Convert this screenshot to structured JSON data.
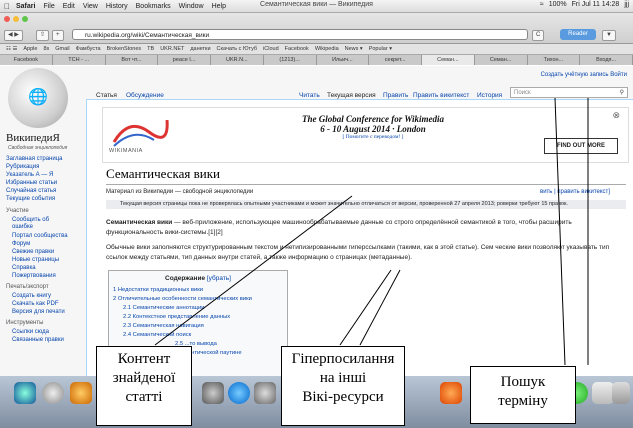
{
  "menubar": {
    "app": "Safari",
    "items": [
      "File",
      "Edit",
      "View",
      "History",
      "Bookmarks",
      "Window",
      "Help"
    ],
    "window_title": "Семантическая вики — Википедия",
    "battery": "100%",
    "clock": "Fri Jul 11  14:28",
    "user": "jjj"
  },
  "toolbar": {
    "url": "ru.wikipedia.org/wiki/Семантическая_вики",
    "reader": "Reader",
    "reload": "C"
  },
  "bookmarks": [
    "Apple",
    "8s",
    "Gmail",
    "Фамбуста",
    "BrokenStones",
    "TB",
    "UKR.NET",
    "данетки",
    "Скачать с Ютуб",
    "iCloud",
    "Facebook",
    "Wikipedia",
    "News ▾",
    "Popular ▾"
  ],
  "tabs": [
    "Facebook",
    "TCH - ...",
    "Вот чт...",
    "peace I...",
    "UKR.N...",
    "(1213)...",
    "Ильич...",
    "секрет...",
    "Семан...",
    "Семан...",
    "Тихон...",
    "Входя..."
  ],
  "wiki": {
    "name": "ВикипедиЯ",
    "tagline": "Свободная энциклопедия",
    "top_links": "Создать учётную запись  Войти",
    "page_tabs": [
      "Статья",
      "Обсуждение"
    ],
    "view_tabs": [
      "Читать",
      "Текущая версия",
      "Править",
      "Править викитекст",
      "История"
    ],
    "search_placeholder": "Поиск",
    "sidebar_nav": [
      "Заглавная страница",
      "Рубрикация",
      "Указатель А — Я",
      "Избранные статьи",
      "Случайная статья",
      "Текущие события"
    ],
    "sidebar_participation_head": "Участие",
    "sidebar_participation": [
      "Сообщить об",
      "ошибке",
      "Портал сообщества",
      "Форум",
      "Свежие правки",
      "Новые страницы",
      "Справка",
      "Пожертвования"
    ],
    "sidebar_print_head": "Печать/экспорт",
    "sidebar_print": [
      "Создать книгу",
      "Скачать как PDF",
      "Версия для печати"
    ],
    "sidebar_tools_head": "Инструменты",
    "sidebar_tools": [
      "Ссылки сюда",
      "Связанные правки"
    ],
    "banner_title_1": "The Global Conference for Wikimedia",
    "banner_title_2": "6 - 10 August 2014 · London",
    "banner_help": "[ Помогите с переводом! ]",
    "banner_logo": "WIKIMANIA",
    "banner_button": "FIND OUT MORE",
    "article_title": "Семантическая вики",
    "from_line": "Материал из Википедии — свободной энциклопедии",
    "edit_links": "вить | править викитекст]",
    "notice": "Текущая версия страницы пока не проверялась опытными участниками и может значительно отличаться от версии, проверенной 27 апреля 2013; роверки требуют 15 правок.",
    "para1_a": "Семантическая вики",
    "para1_b": " — веб-приложение, использующее машинообрабатываемые данные со строго определённой семантикой в           того, чтобы расширить функциональность вики-системы.[1][2]",
    "para2": "Обычные вики заполняются структурированным текстом и нетипизированными гиперссылками (такими, как в этой статье). Сем       ческие вики позволяют указывать тип ссылок между статьями, тип данных внутри статей, а также информацию о страницах (метаданные).",
    "toc_title": "Содержание",
    "toc_hide": "[убрать]",
    "toc": [
      "1 Недостатки традиционных вики",
      "2 Отличительные особенности семантических вики",
      "2.1 Семантические аннотации",
      "2.2 Контекстное представление данных",
      "2.3 Семантическая навигация",
      "2.4 Семантический поиск",
      "2.5 ...то вывода",
      "...в Семантической паутине"
    ]
  },
  "callouts": {
    "content": [
      "Контент",
      "знайденої",
      "статті"
    ],
    "hyperlinks": [
      "Гіперпосилання",
      "на інші",
      "Вікі-ресурси"
    ],
    "search": [
      "Пошук",
      "терміну"
    ]
  }
}
